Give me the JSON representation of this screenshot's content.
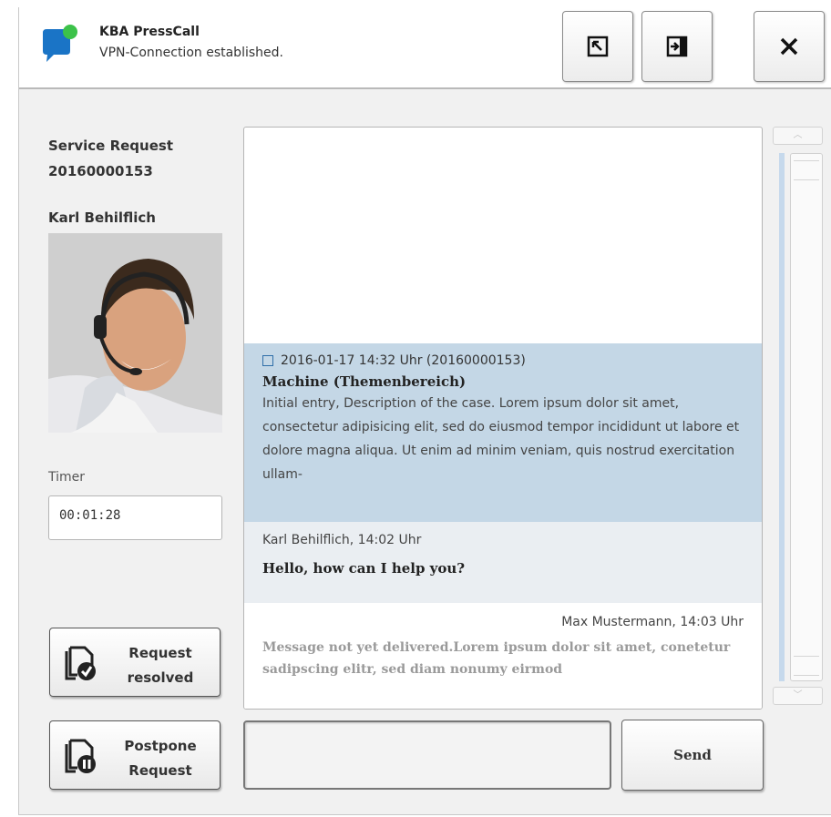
{
  "header": {
    "app_title": "KBA PressCall",
    "status": "VPN-Connection established.",
    "buttons": {
      "minimize_icon": "window-minimize-icon",
      "dock_icon": "window-dock-icon",
      "close_icon": "close-icon",
      "close_label": "✕"
    }
  },
  "sidebar": {
    "service_request_label": "Service Request",
    "service_request_number": "20160000153",
    "agent_name": "Karl Behilflich",
    "timer_label": "Timer",
    "timer_value": "00:01:28",
    "resolved_label": "Request\nresolved",
    "postpone_label": "Postpone\nRequest"
  },
  "chat": {
    "messages": [
      {
        "meta": "2016-01-17 14:32 Uhr (20160000153)",
        "topic": "Machine (Themenbereich)",
        "body": "Initial entry, Description of the case. Lorem ipsum dolor sit amet, consectetur adipisicing elit, sed do eiusmod tempor incididunt ut labore et dolore magna aliqua. Ut enim ad minim veniam, quis nostrud exercitation ullam-"
      },
      {
        "meta": "Karl Behilflich, 14:02 Uhr",
        "text": "Hello, how can I help you?"
      },
      {
        "meta": "Max Mustermann, 14:03 Uhr",
        "text": "Message not yet delivered.Lorem ipsum dolor sit amet, conetetur sadipscing elitr, sed diam nonumy eirmod"
      }
    ]
  },
  "composer": {
    "input_value": "",
    "send_label": "Send"
  },
  "colors": {
    "accent_blue": "#1a74c6",
    "online_green": "#3cc24a",
    "highlight_row": "#c4d7e6",
    "scroll_track": "#c6d9ec"
  }
}
